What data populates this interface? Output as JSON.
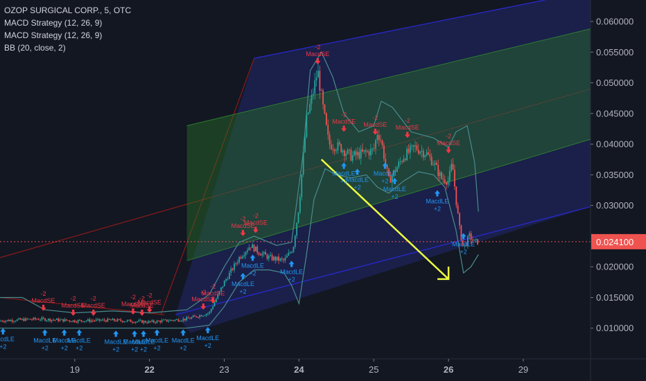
{
  "legend": {
    "symbol": "OZOP SURGICAL CORP., 5, OTC",
    "studies": [
      "MACD Strategy (12, 26, 9)",
      "MACD Strategy (12, 26, 9)",
      "BB (20, close, 2)"
    ]
  },
  "colors": {
    "background": "#131722",
    "axis_text": "#b2b5be",
    "candle_up": "#26a69a",
    "candle_down": "#ef5350",
    "price_line": "#ef5350",
    "buy_signal": "#2196f3",
    "sell_signal": "#f23645",
    "arrow": "#eeff41",
    "channel_blue": "#1a237e",
    "channel_green": "#1b5e20",
    "channel_red": "#8b1a1a",
    "bb_band": "#4a8c8c"
  },
  "chart_data": {
    "type": "candlestick",
    "title": "OZOP SURGICAL CORP., 5, OTC",
    "x_ticks": [
      {
        "t": 19,
        "label": "19",
        "bold": false
      },
      {
        "t": 20,
        "label": "22",
        "bold": true
      },
      {
        "t": 21,
        "label": "23",
        "bold": false
      },
      {
        "t": 22,
        "label": "24",
        "bold": true
      },
      {
        "t": 23,
        "label": "25",
        "bold": false
      },
      {
        "t": 24,
        "label": "26",
        "bold": true
      },
      {
        "t": 25,
        "label": "29",
        "bold": false
      }
    ],
    "y_ticks": [
      "0.060000",
      "0.055000",
      "0.050000",
      "0.045000",
      "0.040000",
      "0.035000",
      "0.030000",
      "0.020000",
      "0.015000",
      "0.010000"
    ],
    "ylim": [
      0.005,
      0.0635
    ],
    "xlim": [
      18.0,
      25.9
    ],
    "current_price": {
      "value": 0.0241,
      "label": "0.024100"
    },
    "price_path": [
      [
        18.0,
        0.0112
      ],
      [
        18.5,
        0.0115
      ],
      [
        19.0,
        0.0112
      ],
      [
        19.5,
        0.0113
      ],
      [
        20.0,
        0.011
      ],
      [
        20.5,
        0.0115
      ],
      [
        20.8,
        0.0125
      ],
      [
        21.0,
        0.0175
      ],
      [
        21.2,
        0.0215
      ],
      [
        21.35,
        0.0235
      ],
      [
        21.45,
        0.0225
      ],
      [
        21.6,
        0.0215
      ],
      [
        21.8,
        0.021
      ],
      [
        21.92,
        0.023
      ],
      [
        22.0,
        0.03
      ],
      [
        22.1,
        0.044
      ],
      [
        22.18,
        0.048
      ],
      [
        22.25,
        0.052
      ],
      [
        22.32,
        0.046
      ],
      [
        22.4,
        0.04
      ],
      [
        22.55,
        0.0395
      ],
      [
        22.7,
        0.038
      ],
      [
        22.85,
        0.0385
      ],
      [
        23.0,
        0.039
      ],
      [
        23.05,
        0.042
      ],
      [
        23.1,
        0.0405
      ],
      [
        23.2,
        0.034
      ],
      [
        23.3,
        0.036
      ],
      [
        23.4,
        0.038
      ],
      [
        23.55,
        0.0395
      ],
      [
        23.7,
        0.0385
      ],
      [
        23.8,
        0.037
      ],
      [
        23.9,
        0.0345
      ],
      [
        24.0,
        0.034
      ],
      [
        24.05,
        0.037
      ],
      [
        24.1,
        0.031
      ],
      [
        24.15,
        0.026
      ],
      [
        24.2,
        0.023
      ],
      [
        24.28,
        0.025
      ],
      [
        24.35,
        0.024
      ],
      [
        24.4,
        0.0241
      ]
    ],
    "channels": {
      "blue": {
        "x": [
          21.4,
          25.9
        ],
        "upper": [
          0.054,
          0.065
        ],
        "lower": [
          0.0125,
          0.0298
        ]
      },
      "green": {
        "x": [
          20.5,
          25.9
        ],
        "upper": [
          0.043,
          0.0588
        ],
        "lower": [
          0.021,
          0.0408
        ]
      },
      "red_center": {
        "x": [
          18.0,
          25.9
        ],
        "y": [
          0.0215,
          0.049
        ]
      }
    },
    "bollinger": {
      "upper": [
        [
          18.0,
          0.015
        ],
        [
          18.3,
          0.015
        ],
        [
          18.6,
          0.013
        ],
        [
          19.0,
          0.0125
        ],
        [
          19.5,
          0.0128
        ],
        [
          20.0,
          0.0125
        ],
        [
          20.5,
          0.013
        ],
        [
          20.8,
          0.0155
        ],
        [
          21.0,
          0.02
        ],
        [
          21.2,
          0.024
        ],
        [
          21.4,
          0.025
        ],
        [
          21.7,
          0.0235
        ],
        [
          21.9,
          0.024
        ],
        [
          22.05,
          0.038
        ],
        [
          22.15,
          0.052
        ],
        [
          22.3,
          0.055
        ],
        [
          22.45,
          0.051
        ],
        [
          22.6,
          0.045
        ],
        [
          22.8,
          0.042
        ],
        [
          23.0,
          0.043
        ],
        [
          23.1,
          0.047
        ],
        [
          23.25,
          0.046
        ],
        [
          23.5,
          0.042
        ],
        [
          23.8,
          0.041
        ],
        [
          24.0,
          0.0395
        ],
        [
          24.1,
          0.042
        ],
        [
          24.25,
          0.043
        ],
        [
          24.35,
          0.037
        ],
        [
          24.4,
          0.029
        ]
      ],
      "lower": [
        [
          18.0,
          0.01
        ],
        [
          18.5,
          0.01
        ],
        [
          19.0,
          0.01
        ],
        [
          19.5,
          0.01
        ],
        [
          20.0,
          0.01
        ],
        [
          20.5,
          0.01
        ],
        [
          20.8,
          0.0105
        ],
        [
          21.0,
          0.0135
        ],
        [
          21.2,
          0.0175
        ],
        [
          21.4,
          0.0195
        ],
        [
          21.6,
          0.0195
        ],
        [
          21.8,
          0.019
        ],
        [
          21.9,
          0.017
        ],
        [
          22.0,
          0.014
        ],
        [
          22.1,
          0.022
        ],
        [
          22.2,
          0.031
        ],
        [
          22.35,
          0.036
        ],
        [
          22.5,
          0.035
        ],
        [
          22.7,
          0.0345
        ],
        [
          22.9,
          0.035
        ],
        [
          23.05,
          0.033
        ],
        [
          23.2,
          0.032
        ],
        [
          23.4,
          0.034
        ],
        [
          23.6,
          0.0355
        ],
        [
          23.8,
          0.035
        ],
        [
          23.95,
          0.033
        ],
        [
          24.1,
          0.026
        ],
        [
          24.2,
          0.019
        ],
        [
          24.3,
          0.02
        ],
        [
          24.4,
          0.022
        ]
      ]
    },
    "signals": [
      {
        "x": 18.58,
        "y": 0.0128,
        "kind": "sell",
        "label": "MacdSE",
        "qty": "-2"
      },
      {
        "x": 18.98,
        "y": 0.012,
        "kind": "sell",
        "label": "MacdSE",
        "qty": "-2"
      },
      {
        "x": 19.25,
        "y": 0.012,
        "kind": "sell",
        "label": "MacdSE",
        "qty": "-2"
      },
      {
        "x": 19.78,
        "y": 0.0122,
        "kind": "sell",
        "label": "MacdSE",
        "qty": "-2"
      },
      {
        "x": 19.9,
        "y": 0.012,
        "kind": "sell",
        "label": "MacdSE",
        "qty": "-2"
      },
      {
        "x": 20.0,
        "y": 0.0125,
        "kind": "sell",
        "label": "MacdSE",
        "qty": "-2"
      },
      {
        "x": 20.72,
        "y": 0.013,
        "kind": "sell",
        "label": "MacdSE",
        "qty": "-2"
      },
      {
        "x": 20.85,
        "y": 0.014,
        "kind": "sell",
        "label": "MacdSE",
        "qty": "-2"
      },
      {
        "x": 21.25,
        "y": 0.025,
        "kind": "sell",
        "label": "MacdSE",
        "qty": "-2"
      },
      {
        "x": 21.42,
        "y": 0.0255,
        "kind": "sell",
        "label": "MacdSE",
        "qty": "-2"
      },
      {
        "x": 22.25,
        "y": 0.053,
        "kind": "sell",
        "label": "MacdSE",
        "qty": "-2"
      },
      {
        "x": 22.6,
        "y": 0.042,
        "kind": "sell",
        "label": "MacdSE",
        "qty": "-2"
      },
      {
        "x": 23.02,
        "y": 0.0415,
        "kind": "sell",
        "label": "MacdSE",
        "qty": "-2"
      },
      {
        "x": 23.45,
        "y": 0.041,
        "kind": "sell",
        "label": "MacdSE",
        "qty": "-2"
      },
      {
        "x": 24.0,
        "y": 0.0385,
        "kind": "sell",
        "label": "MacdSE",
        "qty": "-2"
      },
      {
        "x": 18.04,
        "y": 0.01,
        "kind": "buy",
        "label": "MacdLE",
        "qty": "+2"
      },
      {
        "x": 18.6,
        "y": 0.0098,
        "kind": "buy",
        "label": "MacdLE",
        "qty": "+2"
      },
      {
        "x": 18.86,
        "y": 0.0098,
        "kind": "buy",
        "label": "MacdLE",
        "qty": "+2"
      },
      {
        "x": 19.06,
        "y": 0.0098,
        "kind": "buy",
        "label": "MacdLE",
        "qty": "+2"
      },
      {
        "x": 19.55,
        "y": 0.0096,
        "kind": "buy",
        "label": "MacdLE",
        "qty": "+2"
      },
      {
        "x": 19.8,
        "y": 0.0096,
        "kind": "buy",
        "label": "MacdLE",
        "qty": "+2"
      },
      {
        "x": 19.92,
        "y": 0.0096,
        "kind": "buy",
        "label": "MacdLE",
        "qty": "+2"
      },
      {
        "x": 20.1,
        "y": 0.0098,
        "kind": "buy",
        "label": "MacdLE",
        "qty": "+2"
      },
      {
        "x": 20.45,
        "y": 0.0098,
        "kind": "buy",
        "label": "MacdLE",
        "qty": "+2"
      },
      {
        "x": 20.78,
        "y": 0.0102,
        "kind": "buy",
        "label": "MacdLE",
        "qty": "+2"
      },
      {
        "x": 21.25,
        "y": 0.019,
        "kind": "buy",
        "label": "MacdLE",
        "qty": "+2"
      },
      {
        "x": 21.38,
        "y": 0.022,
        "kind": "buy",
        "label": "MacdLE",
        "qty": "+2"
      },
      {
        "x": 21.9,
        "y": 0.021,
        "kind": "buy",
        "label": "MacdLE",
        "qty": "+2"
      },
      {
        "x": 22.6,
        "y": 0.037,
        "kind": "buy",
        "label": "MacdLE",
        "qty": "+2"
      },
      {
        "x": 22.78,
        "y": 0.036,
        "kind": "buy",
        "label": "MacdLE",
        "qty": "+2"
      },
      {
        "x": 23.15,
        "y": 0.037,
        "kind": "buy",
        "label": "MacdLE",
        "qty": "+2"
      },
      {
        "x": 23.28,
        "y": 0.0345,
        "kind": "buy",
        "label": "MacdLE",
        "qty": "+2"
      },
      {
        "x": 23.85,
        "y": 0.0325,
        "kind": "buy",
        "label": "MacdLE",
        "qty": "+2"
      },
      {
        "x": 24.2,
        "y": 0.0255,
        "kind": "buy",
        "label": "MacdLE",
        "qty": "+2"
      }
    ],
    "arrow": {
      "from": [
        22.3,
        0.0375
      ],
      "to": [
        24.0,
        0.018
      ]
    }
  }
}
